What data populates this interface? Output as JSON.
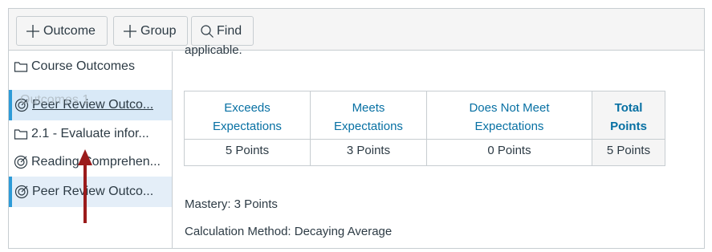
{
  "toolbar": {
    "outcome_label": "Outcome",
    "group_label": "Group",
    "find_label": "Find"
  },
  "sidebar": {
    "items": [
      {
        "label": "Course Outcomes",
        "icon": "folder-icon"
      },
      {
        "label": "Peer Review Outco...",
        "icon": "outcome-target-icon",
        "ghost_label": "Outcomes 1"
      },
      {
        "label": "2.1 - Evaluate infor...",
        "icon": "folder-icon"
      },
      {
        "label": "Reading Comprehen...",
        "icon": "outcome-target-icon"
      },
      {
        "label": "Peer Review Outco...",
        "icon": "outcome-target-icon"
      }
    ]
  },
  "main": {
    "cutoff_text": "applicable.",
    "rubric": {
      "headers": [
        {
          "line1": "Exceeds",
          "line2": "Expectations"
        },
        {
          "line1": "Meets",
          "line2": "Expectations"
        },
        {
          "line1": "Does Not Meet",
          "line2": "Expectations"
        },
        {
          "line1": "Total",
          "line2": "Points"
        }
      ],
      "points": [
        "5 Points",
        "3 Points",
        "0 Points",
        "5 Points"
      ]
    },
    "mastery": "Mastery: 3 Points",
    "calculation": "Calculation Method: Decaying Average"
  },
  "colors": {
    "accent": "#2d9bd8",
    "link": "#0770a3",
    "annotation_arrow": "#9b1b1b"
  }
}
